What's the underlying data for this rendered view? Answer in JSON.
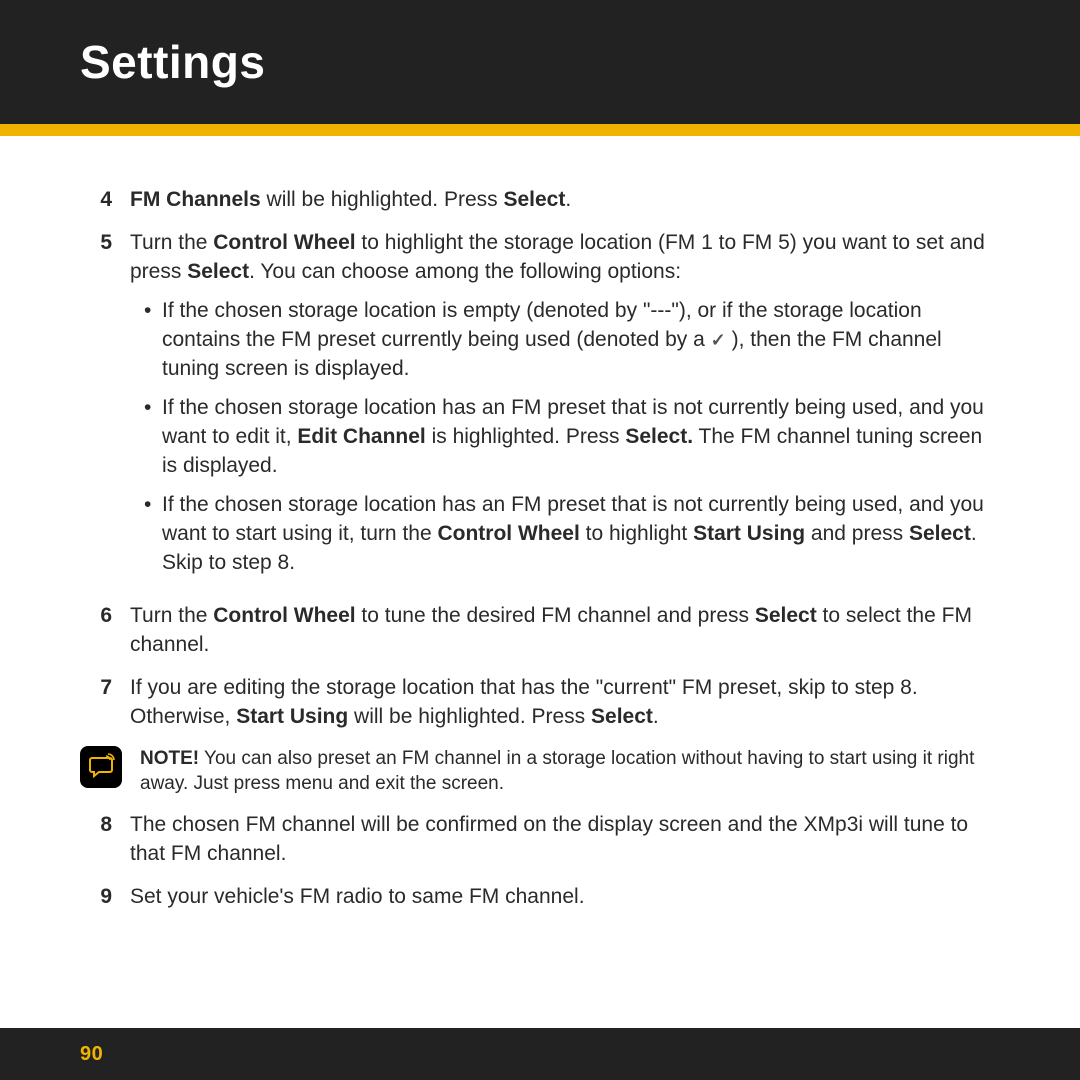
{
  "header": {
    "title": "Settings"
  },
  "steps": {
    "s4": {
      "num": "4",
      "a": "FM Channels",
      "b": " will be highlighted. Press ",
      "c": "Select",
      "d": "."
    },
    "s5": {
      "num": "5",
      "a": "Turn the ",
      "b": "Control Wheel",
      "c": " to highlight the storage location (FM 1 to FM 5) you want to set and press ",
      "d": "Select",
      "e": ". You can choose among the following options:",
      "bul1a": "If the chosen storage location is empty (denoted by \"---\"), or if the storage location contains the FM preset currently being used (denoted by a  ",
      "bul1b": " ), then the FM channel tuning screen is displayed.",
      "bul2a": "If the chosen storage location has an FM preset that is not currently being used, and you want to edit it, ",
      "bul2b": "Edit Channel",
      "bul2c": " is highlighted. Press ",
      "bul2d": "Select.",
      "bul2e": " The FM channel tuning screen is displayed.",
      "bul3a": "If the chosen storage location has an FM preset that is not currently being used, and you want to start using it, turn the ",
      "bul3b": "Control Wheel",
      "bul3c": " to highlight ",
      "bul3d": "Start Using",
      "bul3e": " and press ",
      "bul3f": "Select",
      "bul3g": ". Skip to step 8."
    },
    "s6": {
      "num": "6",
      "a": "Turn the ",
      "b": "Control Wheel",
      "c": " to tune the desired FM channel and press ",
      "d": "Select",
      "e": " to select the FM channel."
    },
    "s7": {
      "num": "7",
      "a": "If you are editing the storage location that has the \"current\" FM preset, skip to step 8. Otherwise, ",
      "b": "Start Using",
      "c": " will be highlighted. Press ",
      "d": "Select",
      "e": "."
    },
    "note": {
      "a": "NOTE!",
      "b": " You can also preset an FM channel in a storage location without having to start using it right away. Just press menu and exit the screen."
    },
    "s8": {
      "num": "8",
      "a": "The chosen FM channel will be confirmed on the display screen and the XMp3i will tune to that FM channel."
    },
    "s9": {
      "num": "9",
      "a": "Set your vehicle's FM radio to same FM channel."
    }
  },
  "pageNumber": "90",
  "bulletGlyph": "•",
  "checkGlyph": "✓"
}
